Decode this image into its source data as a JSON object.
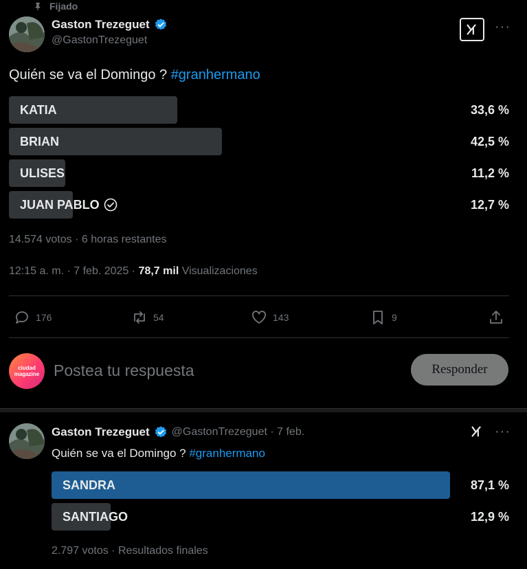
{
  "pinned_label": "Fijado",
  "tweet1": {
    "author": "Gaston Trezeguet",
    "handle": "@GastonTrezeguet",
    "text_prefix": "Quién se va el Domingo ? ",
    "hashtag": "#granhermano",
    "poll": [
      {
        "label": "KATIA",
        "pct_text": "33,6 %",
        "pct": 33.6,
        "voted": false
      },
      {
        "label": "BRIAN",
        "pct_text": "42,5 %",
        "pct": 42.5,
        "voted": false
      },
      {
        "label": "ULISES",
        "pct_text": "11,2 %",
        "pct": 11.2,
        "voted": false
      },
      {
        "label": "JUAN PABLO",
        "pct_text": "12,7 %",
        "pct": 12.7,
        "voted": true
      }
    ],
    "poll_meta": "14.574 votos · 6 horas restantes",
    "timestamp": "12:15 a. m. · 7 feb. 2025 · ",
    "views_count": "78,7 mil",
    "views_label": " Visualizaciones",
    "actions": {
      "replies": "176",
      "reposts": "54",
      "likes": "143",
      "bookmarks": "9"
    }
  },
  "reply_box": {
    "avatar_text_1": "ciudad",
    "avatar_text_2": "magazine",
    "placeholder": "Postea tu respuesta",
    "button_label": "Responder"
  },
  "tweet2": {
    "author": "Gaston Trezeguet",
    "handle_date": "@GastonTrezeguet · 7 feb.",
    "text_prefix": "Quién se va el Domingo ? ",
    "hashtag": "#granhermano",
    "poll": [
      {
        "label": "SANDRA",
        "pct_text": "87,1 %",
        "pct": 87.1,
        "winner": true
      },
      {
        "label": "SANTIAGO",
        "pct_text": "12,9 %",
        "pct": 12.9,
        "winner": false
      }
    ],
    "poll_meta": "2.797 votos · Resultados finales"
  },
  "colors": {
    "background": "#000000",
    "poll_bar": "#333639",
    "poll_bar_winner": "#1d5d93",
    "accent": "#1d9bf0",
    "muted": "#71767b"
  }
}
